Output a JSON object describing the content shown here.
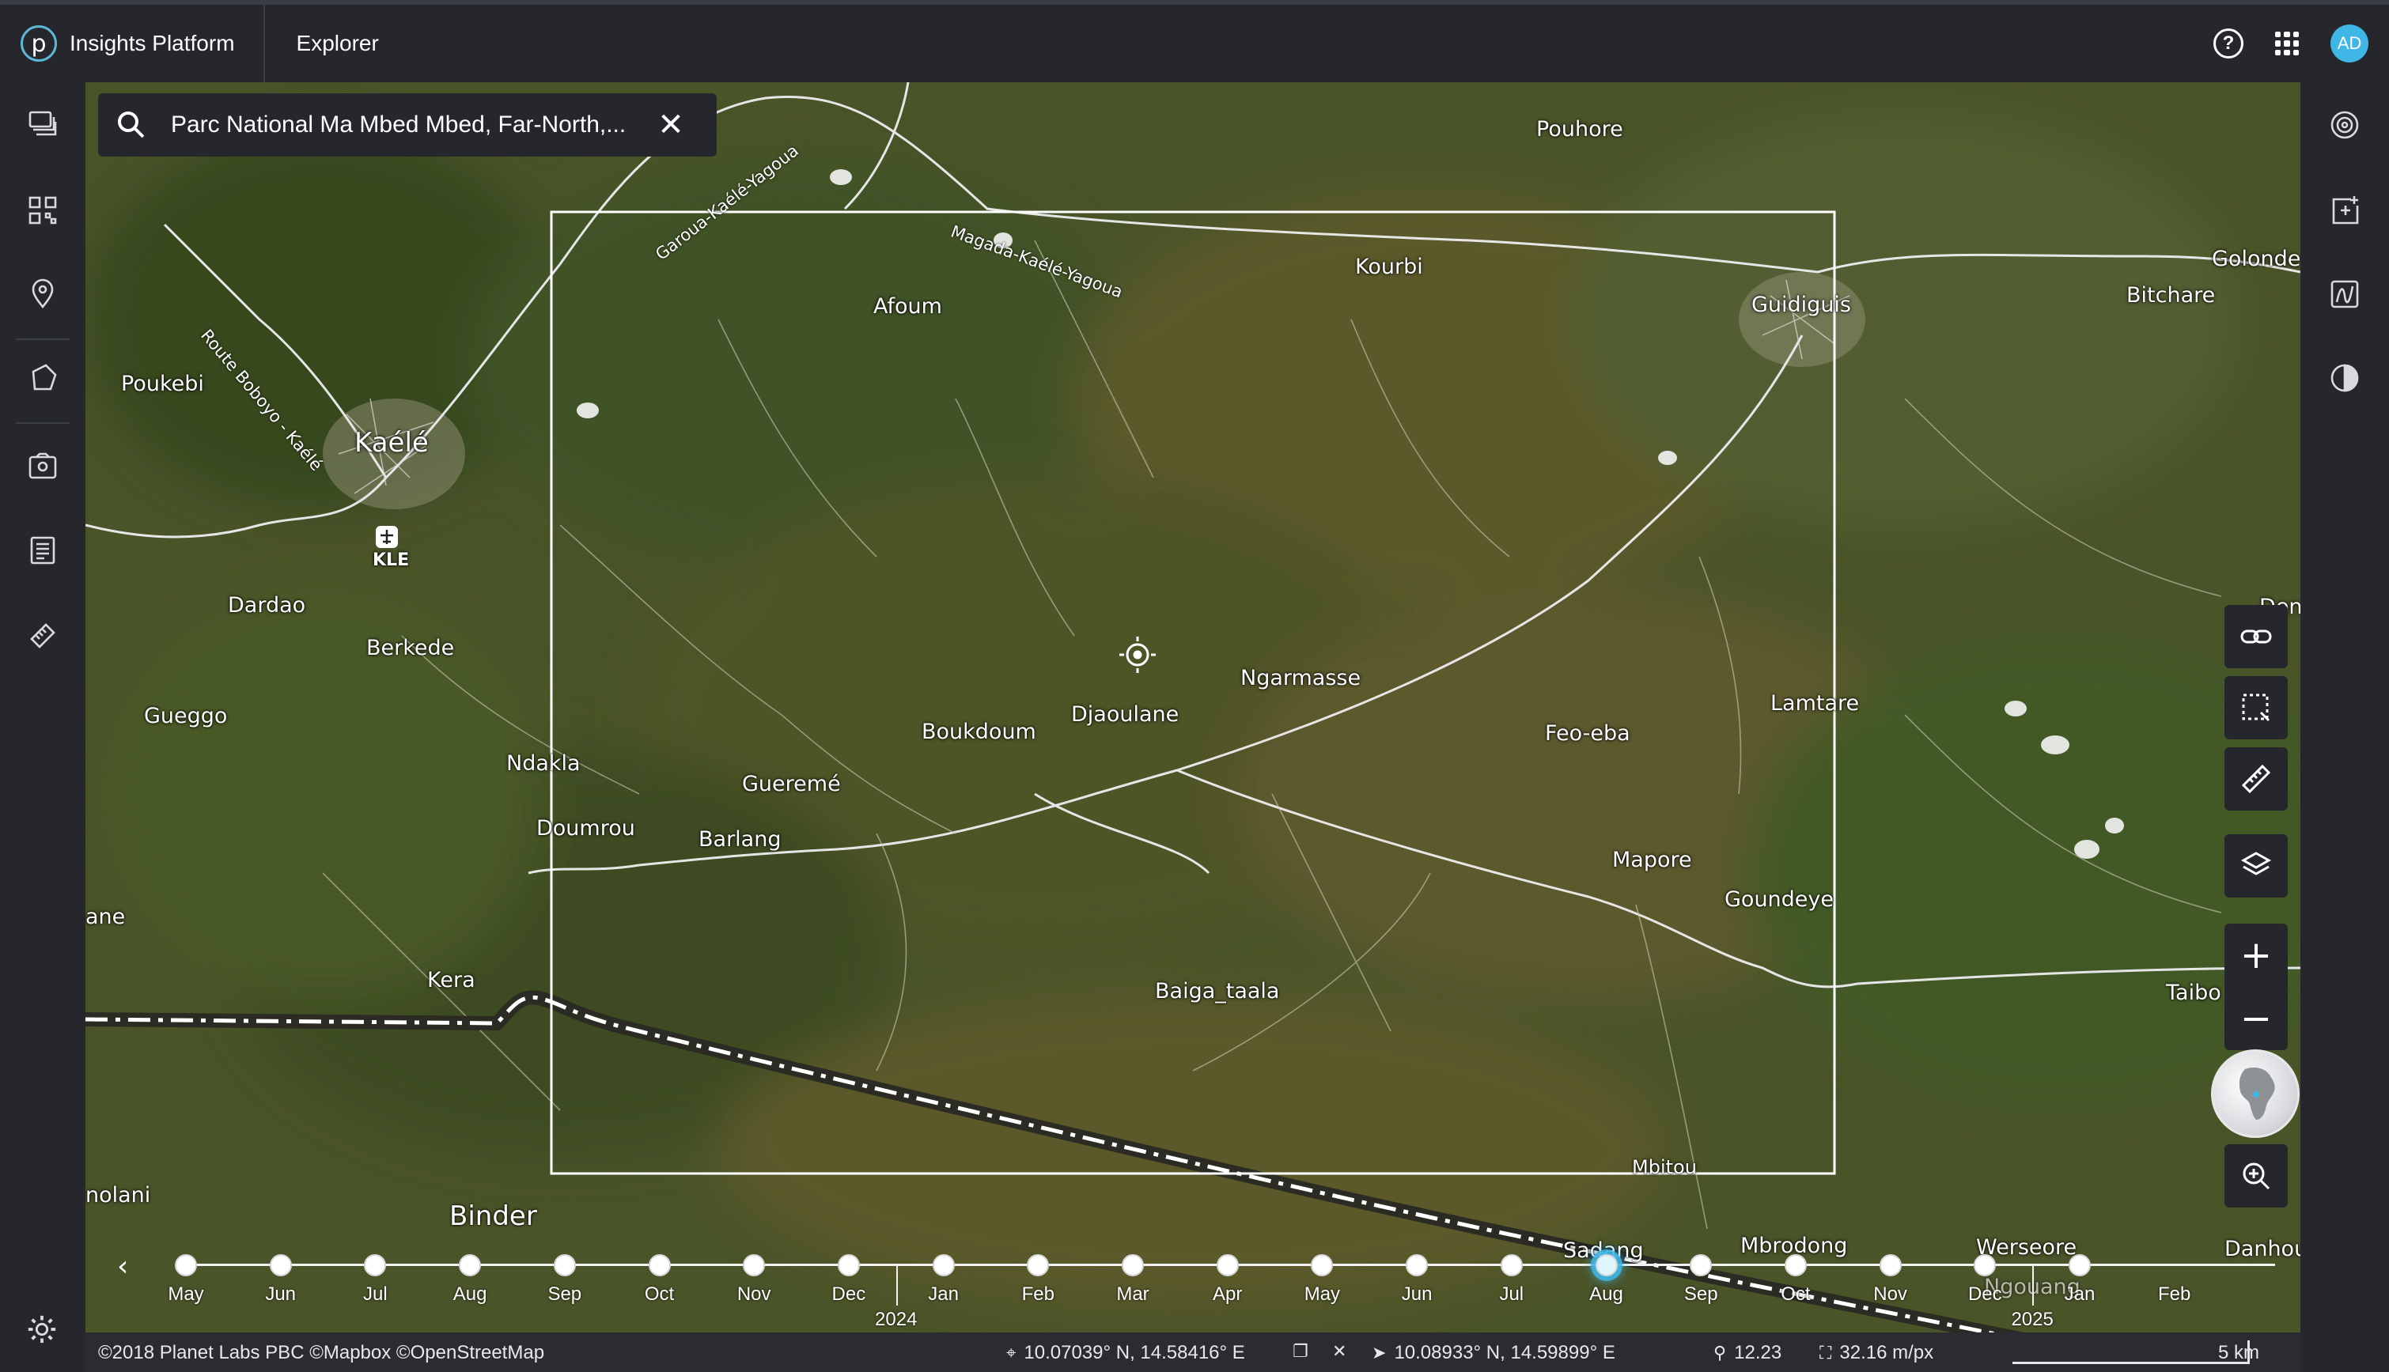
{
  "header": {
    "app_name": "Insights Platform",
    "logo_letter": "p",
    "section": "Explorer",
    "avatar_initials": "AD",
    "colors": {
      "accent": "#3fb6e6",
      "bar": "#25272c"
    }
  },
  "left_rail": {
    "items": [
      "layers-stack-icon",
      "grid-qr-icon",
      "location-pin-icon",
      "polygon-icon",
      "photo-location-icon",
      "list-document-icon",
      "tag-ruler-icon"
    ],
    "settings_icon": "gear-icon"
  },
  "right_rail": {
    "items": [
      "radar-scan-icon",
      "add-panel-icon",
      "chart-frame-icon",
      "contrast-icon"
    ]
  },
  "search": {
    "value": "Parc National Ma Mbed Mbed, Far-North,...",
    "placeholder": "Search"
  },
  "map": {
    "places": [
      {
        "name": "Pouhore"
      },
      {
        "name": "Kourbi"
      },
      {
        "name": "Guidiguis"
      },
      {
        "name": "Golonde"
      },
      {
        "name": "Bitchare"
      },
      {
        "name": "Afoum"
      },
      {
        "name": "Poukebi"
      },
      {
        "name": "Kaélé"
      },
      {
        "name": "KLE"
      },
      {
        "name": "Dardao"
      },
      {
        "name": "Berkede"
      },
      {
        "name": "Gueggo"
      },
      {
        "name": "Ndakla"
      },
      {
        "name": "Doumrou"
      },
      {
        "name": "Gueremé"
      },
      {
        "name": "Barlang"
      },
      {
        "name": "Boukdoum"
      },
      {
        "name": "Djaoulane"
      },
      {
        "name": "Ngarmasse"
      },
      {
        "name": "Lamtare"
      },
      {
        "name": "Feo-eba"
      },
      {
        "name": "Mapore"
      },
      {
        "name": "Goundeye"
      },
      {
        "name": "Baiga_taala"
      },
      {
        "name": "Kera"
      },
      {
        "name": "ane"
      },
      {
        "name": "nolani"
      },
      {
        "name": "Binder"
      },
      {
        "name": "Mbitou"
      },
      {
        "name": "Sadang"
      },
      {
        "name": "Mbrodong"
      },
      {
        "name": "Werseore"
      },
      {
        "name": "Danhou"
      },
      {
        "name": "Taibo"
      },
      {
        "name": "Den"
      },
      {
        "name": "Ngouang"
      }
    ],
    "road_labels": [
      "Magada-Kaélé-Yagoua",
      "Garoua-Kaélé-Yagoua",
      "Route Boboyo - Kaélé"
    ]
  },
  "tools": {
    "link": "link-icon",
    "select": "select-area-icon",
    "measure": "ruler-icon",
    "layers": "layers-icon",
    "zoom_in": "+",
    "zoom_out": "−",
    "zoom_search": "zoom-search-icon"
  },
  "timeline": {
    "months": [
      "May",
      "Jun",
      "Jul",
      "Aug",
      "Sep",
      "Oct",
      "Nov",
      "Dec",
      "Jan",
      "Feb",
      "Mar",
      "Apr",
      "May",
      "Jun",
      "Jul",
      "Aug",
      "Sep",
      "Oct",
      "Nov",
      "Dec",
      "Jan",
      "Feb"
    ],
    "dots": 21,
    "active_index": 15,
    "years": [
      "2024",
      "2025"
    ]
  },
  "status": {
    "attribution": "©2018 Planet Labs PBC ©Mapbox ©OpenStreetMap",
    "center_coord": "10.07039° N, 14.58416° E",
    "cursor_coord": "10.08933° N, 14.59899° E",
    "zoom": "12.23",
    "resolution": "32.16 m/px",
    "scale": "5 km"
  }
}
